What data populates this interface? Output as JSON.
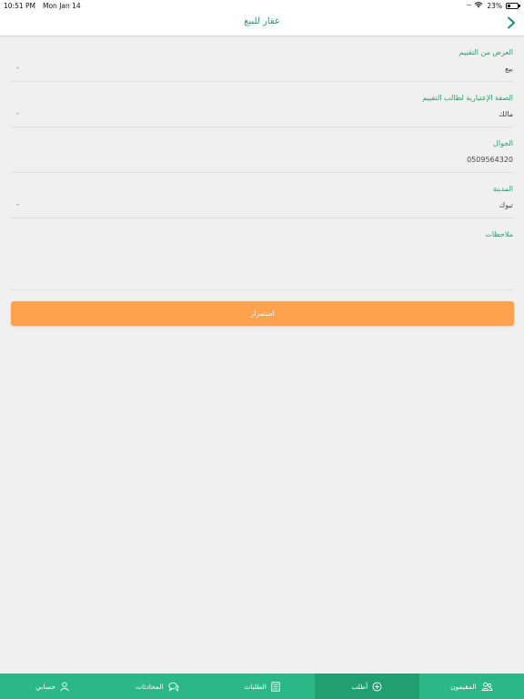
{
  "status_bar": {
    "time": "10:51 PM",
    "date": "Mon Jan 14",
    "battery": "23%"
  },
  "nav": {
    "title": "عقار للبيع",
    "back_icon": "chevron-right-icon"
  },
  "form": {
    "fields": [
      {
        "label": "العرض من التقييم",
        "value": "بيع",
        "caret": "-"
      },
      {
        "label": "الصفة الإعتبارية لطالب التقييم",
        "value": "مالك",
        "caret": "-"
      },
      {
        "label": "الجوال",
        "value": "0509564320"
      },
      {
        "label": "المدينة",
        "value": "تبوك",
        "caret": "-"
      },
      {
        "label": "ملاحظات",
        "value": ""
      }
    ],
    "submit_label": "استمرار"
  },
  "tabs": [
    {
      "label": "المقيمون",
      "icon": "people-icon",
      "active": false
    },
    {
      "label": "أطلب",
      "icon": "plus-circle-icon",
      "active": true
    },
    {
      "label": "الطلبات",
      "icon": "list-icon",
      "active": false
    },
    {
      "label": "المحادثات",
      "icon": "chat-icon",
      "active": false
    },
    {
      "label": "حسابي",
      "icon": "user-icon",
      "active": false
    }
  ],
  "colors": {
    "accent": "#2a9d6f",
    "tab_bar": "#2bb787",
    "tab_active": "#1f9f72",
    "button": "#ffa24f"
  }
}
